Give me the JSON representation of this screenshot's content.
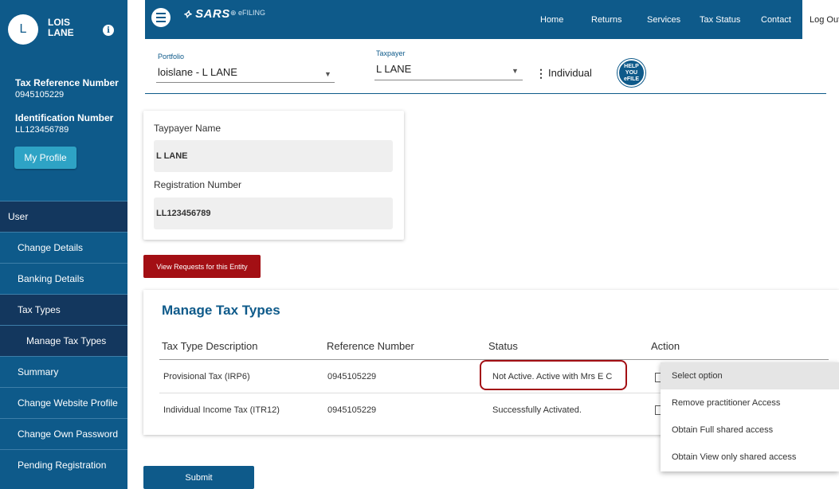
{
  "user": {
    "avatar_initial": "L",
    "name_line1": "LOIS",
    "name_line2": "LANE",
    "info_glyph": "i",
    "tax_ref_label": "Tax Reference Number",
    "tax_ref_value": "0945105229",
    "id_label": "Identification Number",
    "id_value": "LL123456789",
    "profile_button": "My Profile"
  },
  "sidebar": {
    "items": [
      {
        "label": "User",
        "dark": true,
        "kind": "user"
      },
      {
        "label": "Change Details",
        "dark": false,
        "kind": "item"
      },
      {
        "label": "Banking Details",
        "dark": false,
        "kind": "item"
      },
      {
        "label": "Tax Types",
        "dark": true,
        "kind": "item"
      },
      {
        "label": "Manage Tax Types",
        "dark": true,
        "kind": "sub"
      },
      {
        "label": "Summary",
        "dark": false,
        "kind": "item"
      },
      {
        "label": "Change Website Profile",
        "dark": false,
        "kind": "item"
      },
      {
        "label": "Change Own Password",
        "dark": false,
        "kind": "item"
      },
      {
        "label": "Pending Registration",
        "dark": false,
        "kind": "item"
      }
    ]
  },
  "header": {
    "brand": "SARS",
    "brand_sub": "eFILING",
    "nav": [
      "Home",
      "Returns",
      "Services",
      "Tax Status",
      "Contact"
    ],
    "logout": "Log Out"
  },
  "portfolio": {
    "label": "Portfolio",
    "value": "loislane - L LANE"
  },
  "taxpayer": {
    "label": "Taxpayer",
    "value": "L LANE",
    "type": "Individual",
    "help_line1": "HELP",
    "help_line2": "YOU",
    "help_line3": "eFILE"
  },
  "card": {
    "name_label": "Taypayer Name",
    "name_value": "L LANE",
    "reg_label": "Registration Number",
    "reg_value": "LL123456789"
  },
  "view_requests_button": "View Requests for this Entity",
  "manage": {
    "title": "Manage Tax Types",
    "headers": [
      "Tax Type Description",
      "Reference Number",
      "Status",
      "Action"
    ],
    "rows": [
      {
        "description": "Provisional Tax (IRP6)",
        "reference": "0945105229",
        "status": "Not Active. Active with Mrs E C"
      },
      {
        "description": "Individual Income Tax (ITR12)",
        "reference": "0945105229",
        "status": "Successfully Activated."
      }
    ]
  },
  "action_dropdown": {
    "options": [
      "Select option",
      "Remove practitioner Access",
      "Obtain Full shared access",
      "Obtain View only shared access"
    ],
    "selected": "Select option"
  },
  "submit_button": "Submit",
  "colors": {
    "primary": "#0e5a8a",
    "sidebar_dark": "#13375e",
    "danger": "#a30f14",
    "profile_button": "#2ea3c5"
  }
}
